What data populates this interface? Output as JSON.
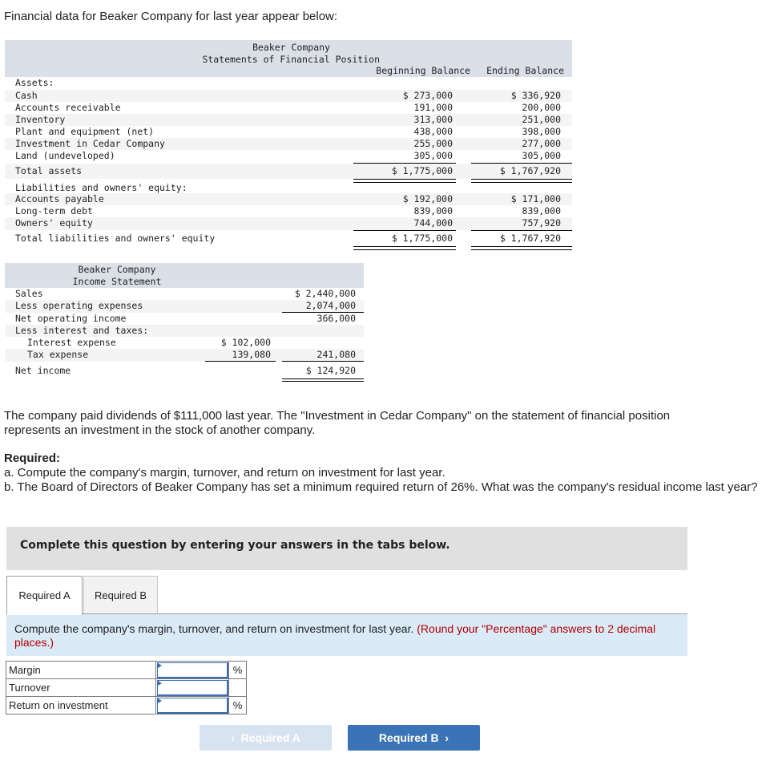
{
  "intro": "Financial data for Beaker Company for last year appear below:",
  "balance_sheet": {
    "company": "Beaker Company",
    "title": "Statements of Financial Position",
    "col_begin": "Beginning Balance",
    "col_end": "Ending Balance",
    "assets_heading": "Assets:",
    "assets": [
      {
        "label": "Cash",
        "begin": "$ 273,000",
        "end": "$ 336,920"
      },
      {
        "label": "Accounts receivable",
        "begin": "191,000",
        "end": "200,000"
      },
      {
        "label": "Inventory",
        "begin": "313,000",
        "end": "251,000"
      },
      {
        "label": "Plant and equipment (net)",
        "begin": "438,000",
        "end": "398,000"
      },
      {
        "label": "Investment in Cedar Company",
        "begin": "255,000",
        "end": "277,000"
      },
      {
        "label": "Land (undeveloped)",
        "begin": "305,000",
        "end": "305,000"
      }
    ],
    "total_assets": {
      "label": "Total assets",
      "begin": "$ 1,775,000",
      "end": "$ 1,767,920"
    },
    "liab_heading": "Liabilities and owners' equity:",
    "liabilities": [
      {
        "label": "Accounts payable",
        "begin": "$ 192,000",
        "end": "$ 171,000"
      },
      {
        "label": "Long-term debt",
        "begin": "839,000",
        "end": "839,000"
      },
      {
        "label": "Owners' equity",
        "begin": "744,000",
        "end": "757,920"
      }
    ],
    "total_liab": {
      "label": "Total liabilities and owners' equity",
      "begin": "$ 1,775,000",
      "end": "$ 1,767,920"
    }
  },
  "income_statement": {
    "company": "Beaker Company",
    "title": "Income Statement",
    "rows": [
      {
        "label": "Sales",
        "c1": "",
        "c2": "$ 2,440,000"
      },
      {
        "label": "Less operating expenses",
        "c1": "",
        "c2": "2,074,000"
      },
      {
        "label": "Net operating income",
        "c1": "",
        "c2": "366,000"
      },
      {
        "label": "Less interest and taxes:",
        "c1": "",
        "c2": ""
      },
      {
        "label": "Interest expense",
        "c1": "$ 102,000",
        "c2": ""
      },
      {
        "label": "Tax expense",
        "c1": "139,080",
        "c2": "241,080"
      },
      {
        "label": "Net income",
        "c1": "",
        "c2": "$ 124,920"
      }
    ]
  },
  "paragraph": "The company paid dividends of $111,000 last year. The \"Investment in Cedar Company\" on the statement of financial position represents an investment in the stock of another company.",
  "required": {
    "heading": "Required:",
    "a": "a. Compute the company's margin, turnover, and return on investment for last year.",
    "b": "b. The Board of Directors of Beaker Company has set a minimum required return of 26%. What was the company's residual income last year?"
  },
  "banner": "Complete this question by entering your answers in the tabs below.",
  "tabs": [
    {
      "label": "Required A",
      "active": true
    },
    {
      "label": "Required B",
      "active": false
    }
  ],
  "instruction": {
    "text": "Compute the company's margin, turnover, and return on investment for last year.",
    "note": "(Round your \"Percentage\" answers to 2 decimal places.)"
  },
  "answers": [
    {
      "label": "Margin",
      "value": "",
      "unit": "%"
    },
    {
      "label": "Turnover",
      "value": "",
      "unit": ""
    },
    {
      "label": "Return on investment",
      "value": "",
      "unit": "%"
    }
  ],
  "nav": {
    "prev_label": "Required A",
    "next_label": "Required B"
  },
  "colors": {
    "header_bg": "#dbdfe8",
    "accent": "#3a74b6",
    "note_red": "#b00000",
    "instr_bg": "#dbeaf7"
  }
}
